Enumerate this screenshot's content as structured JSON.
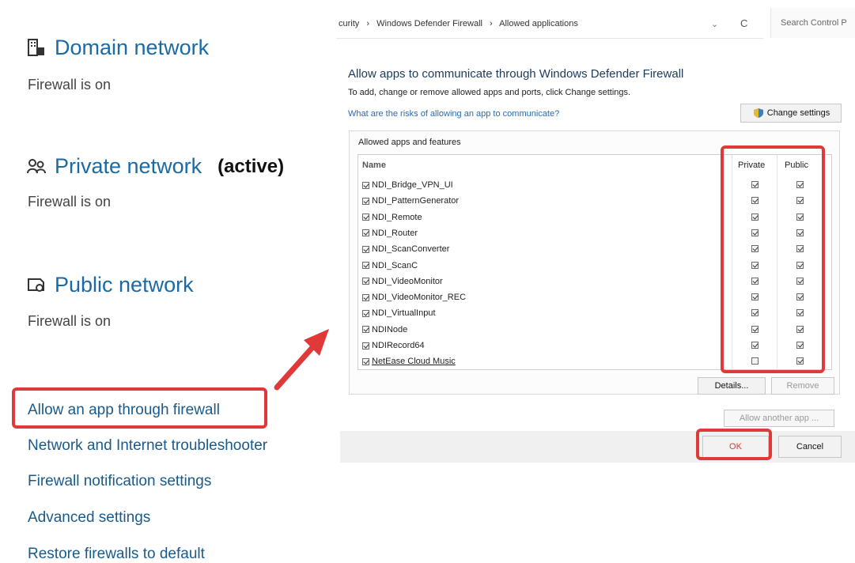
{
  "networks": [
    {
      "name": "Domain network",
      "status": "Firewall is on",
      "icon": "domain-network-icon",
      "active": ""
    },
    {
      "name": "Private network",
      "status": "Firewall is on",
      "icon": "private-network-icon",
      "active": "(active)"
    },
    {
      "name": "Public network",
      "status": "Firewall is on",
      "icon": "public-network-icon",
      "active": ""
    }
  ],
  "links": [
    "Allow an app through firewall",
    "Network and Internet troubleshooter",
    "Firewall notification settings",
    "Advanced settings",
    "Restore firewalls to default"
  ],
  "address_bar": {
    "crumb1": "curity",
    "sep": "›",
    "crumb2": "Windows Defender Firewall",
    "crumb3": "Allowed applications",
    "chevron": "⌄",
    "refresh": "C",
    "search_placeholder": "Search Control P"
  },
  "dialog": {
    "title": "Allow apps to communicate through Windows Defender Firewall",
    "subtitle": "To add, change or remove allowed apps and ports, click Change settings.",
    "risk_link": "What are the risks of allowing an app to communicate?",
    "change_settings": "Change settings",
    "group_label": "Allowed apps and features",
    "col_name": "Name",
    "col_private": "Private",
    "col_public": "Public",
    "apps": [
      {
        "name": "NDI_Bridge_VPN_UI",
        "enabled": true,
        "private": true,
        "public": true
      },
      {
        "name": "NDI_PatternGenerator",
        "enabled": true,
        "private": true,
        "public": true
      },
      {
        "name": "NDI_Remote",
        "enabled": true,
        "private": true,
        "public": true
      },
      {
        "name": "NDI_Router",
        "enabled": true,
        "private": true,
        "public": true
      },
      {
        "name": "NDI_ScanConverter",
        "enabled": true,
        "private": true,
        "public": true
      },
      {
        "name": "NDI_ScanC",
        "enabled": true,
        "private": true,
        "public": true
      },
      {
        "name": "NDI_VideoMonitor",
        "enabled": true,
        "private": true,
        "public": true
      },
      {
        "name": "NDI_VideoMonitor_REC",
        "enabled": true,
        "private": true,
        "public": true
      },
      {
        "name": "NDI_VirtualInput",
        "enabled": true,
        "private": true,
        "public": true
      },
      {
        "name": "NDINode",
        "enabled": true,
        "private": true,
        "public": true
      },
      {
        "name": "NDIRecord64",
        "enabled": true,
        "private": true,
        "public": true
      },
      {
        "name": "NetEase Cloud Music",
        "enabled": true,
        "private": false,
        "public": true
      }
    ],
    "details": "Details...",
    "remove": "Remove",
    "allow_another": "Allow another app ...",
    "ok": "OK",
    "cancel": "Cancel"
  },
  "colors": {
    "highlight": "#e0393a",
    "link_blue": "#1a6aa6"
  }
}
